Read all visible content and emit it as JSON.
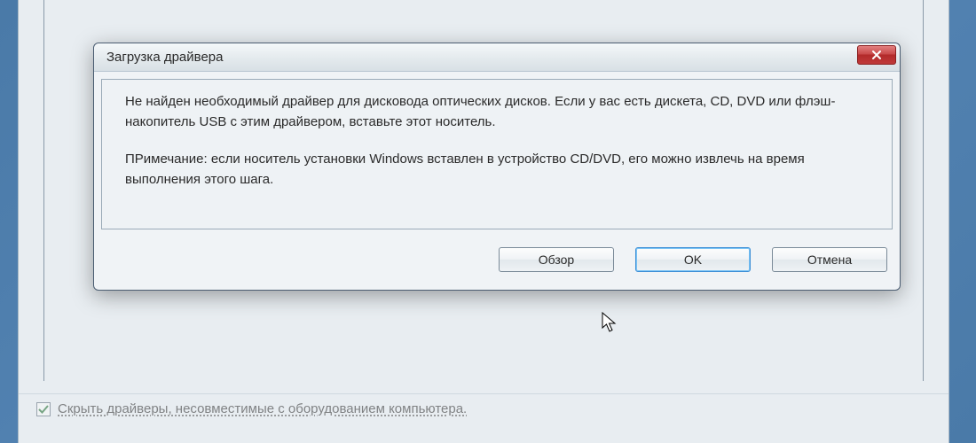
{
  "dialog": {
    "title": "Загрузка драйвера",
    "message1": "Не найден необходимый драйвер для дисковода оптических дисков. Если у вас есть дискета, CD, DVD или флэш-накопитель USB с этим драйвером, вставьте этот носитель.",
    "message2": "ПРимечание: если носитель установки Windows вставлен в устройство CD/DVD, его можно извлечь на время выполнения этого шага.",
    "buttons": {
      "browse": "Обзор",
      "ok": "OK",
      "cancel": "Отмена"
    }
  },
  "background": {
    "checkbox_label": "Скрыть драйверы, несовместимые с оборудованием компьютера.",
    "checkbox_checked": true
  }
}
